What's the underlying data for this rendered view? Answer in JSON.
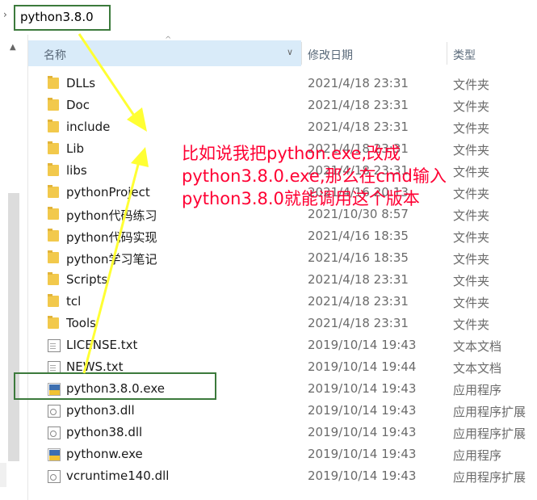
{
  "address_bar": {
    "chevron": "›",
    "path": "python3.8.0"
  },
  "columns": {
    "name": "名称",
    "date": "修改日期",
    "type": "类型"
  },
  "files": [
    {
      "name": "DLLs",
      "date": "2021/4/18 23:31",
      "type": "文件夹",
      "icon": "folder-icon"
    },
    {
      "name": "Doc",
      "date": "2021/4/18 23:31",
      "type": "文件夹",
      "icon": "folder-icon"
    },
    {
      "name": "include",
      "date": "2021/4/18 23:31",
      "type": "文件夹",
      "icon": "folder-icon"
    },
    {
      "name": "Lib",
      "date": "2021/4/18 23:31",
      "type": "文件夹",
      "icon": "folder-icon"
    },
    {
      "name": "libs",
      "date": "2021/4/18 23:31",
      "type": "文件夹",
      "icon": "folder-icon"
    },
    {
      "name": "pythonProject",
      "date": "2021/4/16 20:13",
      "type": "文件夹",
      "icon": "folder-icon"
    },
    {
      "name": "python代码练习",
      "date": "2021/10/30 8:57",
      "type": "文件夹",
      "icon": "folder-icon"
    },
    {
      "name": "python代码实现",
      "date": "2021/4/16 18:35",
      "type": "文件夹",
      "icon": "folder-icon"
    },
    {
      "name": "python学习笔记",
      "date": "2021/4/16 18:35",
      "type": "文件夹",
      "icon": "folder-icon"
    },
    {
      "name": "Scripts",
      "date": "2021/4/18 23:31",
      "type": "文件夹",
      "icon": "folder-icon"
    },
    {
      "name": "tcl",
      "date": "2021/4/18 23:31",
      "type": "文件夹",
      "icon": "folder-icon"
    },
    {
      "name": "Tools",
      "date": "2021/4/18 23:31",
      "type": "文件夹",
      "icon": "folder-icon"
    },
    {
      "name": "LICENSE.txt",
      "date": "2019/10/14 19:43",
      "type": "文本文档",
      "icon": "text-file-icon"
    },
    {
      "name": "NEWS.txt",
      "date": "2019/10/14 19:44",
      "type": "文本文档",
      "icon": "text-file-icon"
    },
    {
      "name": "python3.8.0.exe",
      "date": "2019/10/14 19:43",
      "type": "应用程序",
      "icon": "python-exe-icon"
    },
    {
      "name": "python3.dll",
      "date": "2019/10/14 19:43",
      "type": "应用程序扩展",
      "icon": "dll-file-icon"
    },
    {
      "name": "python38.dll",
      "date": "2019/10/14 19:43",
      "type": "应用程序扩展",
      "icon": "dll-file-icon"
    },
    {
      "name": "pythonw.exe",
      "date": "2019/10/14 19:43",
      "type": "应用程序",
      "icon": "python-exe-icon"
    },
    {
      "name": "vcruntime140.dll",
      "date": "2019/10/14 19:43",
      "type": "应用程序扩展",
      "icon": "dll-file-icon"
    }
  ],
  "annotation": {
    "lines": [
      "比如说我把python.exe,改成",
      "python3.8.0.exe,那么在cmd输入",
      "python3.8.0就能调用这个版本"
    ]
  },
  "colors": {
    "annotation": "#ff0033",
    "highlight_box": "#3c7a3c",
    "arrow": "#ffff33",
    "header_selected": "#d9ebf9"
  }
}
